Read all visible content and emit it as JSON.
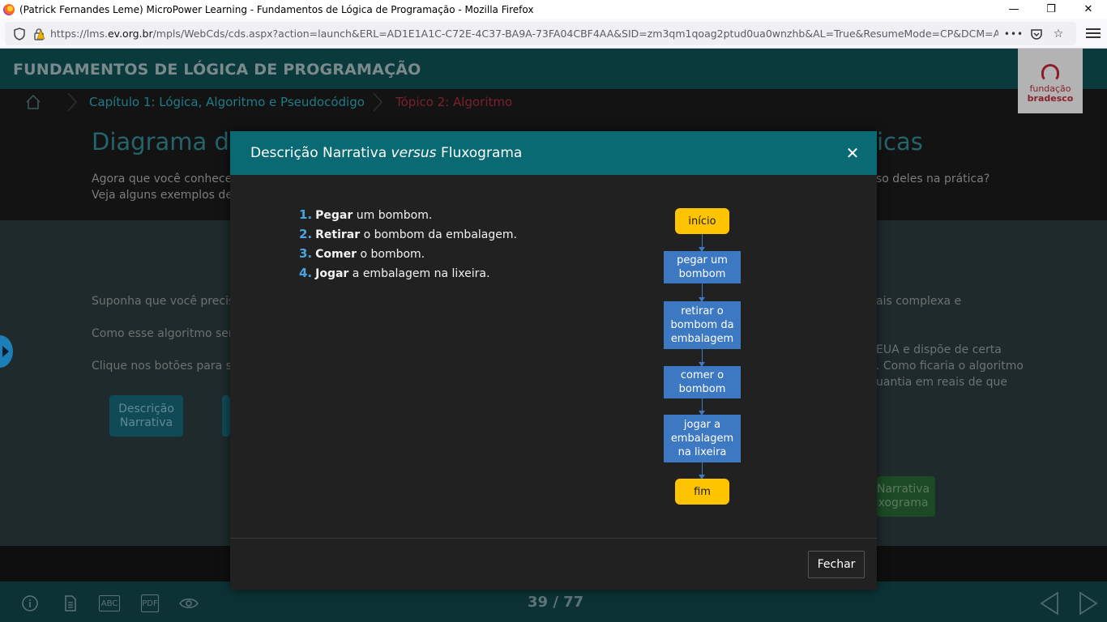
{
  "window": {
    "title": "(Patrick Fernandes Leme) MicroPower Learning - Fundamentos de Lógica de Programação - Mozilla Firefox",
    "minimize": "—",
    "restore": "❐",
    "close": "✕"
  },
  "browser": {
    "url_prefix": "https://lms.",
    "url_domain": "ev.org.br",
    "url_rest": "/mpls/WebCds/cds.aspx?action=launch&ERL=AD1E1A1C-C72E-4C37-BA9A-73FA04CBF4AA&SID=zm3qm1qoag2ptud0ua0wnzhb&AL=True&ResumeMode=CP&DCM=A",
    "more_label": "•••",
    "bookmark_icon": "☆",
    "pocket_icon": "⛉"
  },
  "course": {
    "title": "FUNDAMENTOS DE LÓGICA DE PROGRAMAÇÃO",
    "logo_line1": "fundação",
    "logo_line2": "bradesco"
  },
  "breadcrumb": {
    "chapter": "Capítulo 1: Lógica, Algoritmo e Pseudocódigo",
    "topic": "Tópico 2: Algoritmo"
  },
  "page": {
    "heading_start": "Diagrama de",
    "heading_end": "icas",
    "intro_line1_start": "Agora que você conhece o",
    "intro_line1_end": "so deles na prática?",
    "intro_line2_start": "Veja alguns exemplos de o",
    "para1_start": "Suponha que você precise",
    "para1_end": "ais complexa e",
    "para2_start": "Como esse algoritmo seria",
    "para3_start": "Clique nos botões para sal",
    "right_line1": "EUA e dispõe de certa",
    "right_line2": ". Como ficaria o algoritmo",
    "right_line3": "uantia em reais de que",
    "btn_descricao": "Descrição Narrativa",
    "btn_green": "Narrativa\nxograma"
  },
  "footer": {
    "page_counter": "39 / 77",
    "icon_abc": "ABC",
    "icon_pdf": "PDF"
  },
  "modal": {
    "title_part1": "Descrição Narrativa ",
    "title_italic": "versus",
    "title_part2": " Fluxograma",
    "close_icon": "✕",
    "steps": [
      {
        "num": "1.",
        "verb": "Pegar",
        "rest": " um bombom."
      },
      {
        "num": "2.",
        "verb": "Retirar",
        "rest": " o bombom da embalagem."
      },
      {
        "num": "3.",
        "verb": "Comer",
        "rest": " o bombom."
      },
      {
        "num": "4.",
        "verb": "Jogar",
        "rest": " a embalagem na lixeira."
      }
    ],
    "flow": {
      "start": "início",
      "p1": "pegar um bombom",
      "p2": "retirar o bombom da embalagem",
      "p3": "comer o bombom",
      "p4": "jogar a embalagem na lixeira",
      "end": "fim"
    },
    "close_button": "Fechar"
  }
}
